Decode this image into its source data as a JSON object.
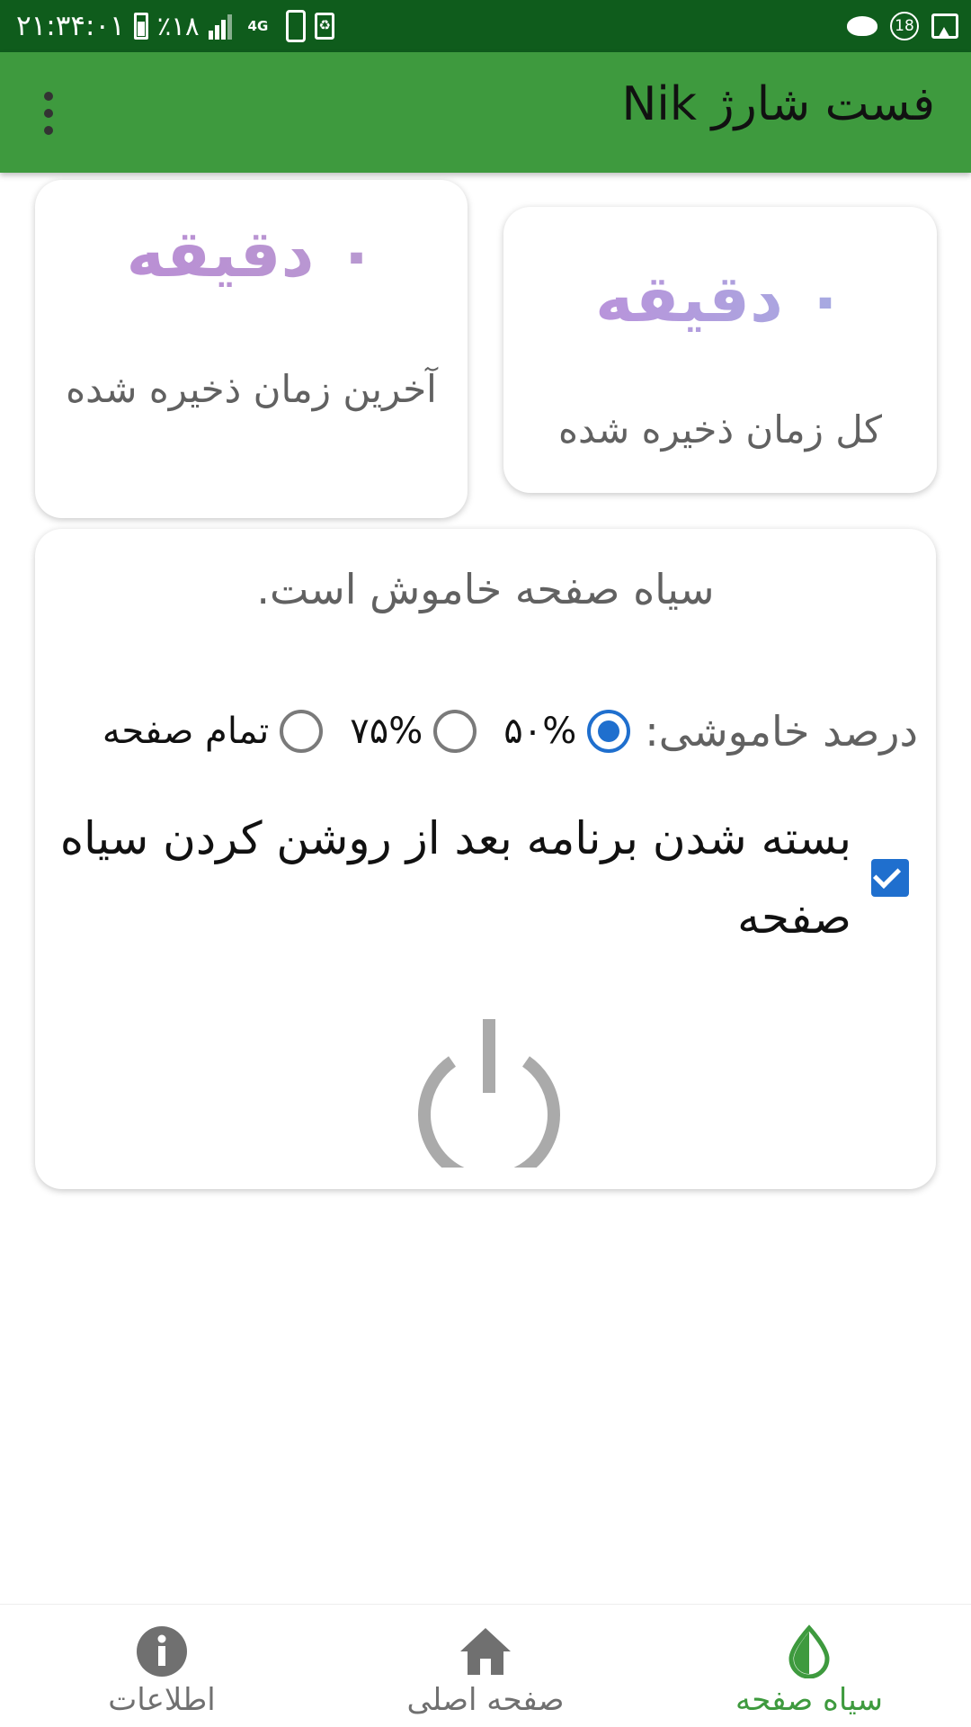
{
  "status_bar": {
    "time": "۲۱:۳۴:۰۱",
    "battery_percent": "٪۱۸",
    "network": "4G",
    "notification_badge": "18"
  },
  "app_bar": {
    "title": "فست شارژ Nik",
    "more_icon": "more-vert-icon"
  },
  "stats": {
    "last_saved": {
      "value": "۰ دقیقه",
      "label": "آخرین زمان ذخیره شده"
    },
    "total_saved": {
      "value": "۰ دقیقه",
      "label": "کل زمان ذخیره شده"
    }
  },
  "black_screen": {
    "status_text": "سیاه صفحه خاموش است.",
    "percent_label": "درصد خاموشی:",
    "options": [
      {
        "label": "۵۰%",
        "checked": true
      },
      {
        "label": "۷۵%",
        "checked": false
      },
      {
        "label": "تمام صفحه",
        "checked": false
      }
    ],
    "close_after_label": "بسته شدن برنامه بعد از روشن کردن سیاه صفحه",
    "close_after_checked": true,
    "power_icon": "power-icon"
  },
  "bottom_nav": {
    "items": [
      {
        "label": "سیاه صفحه",
        "icon": "drop-half-icon",
        "active": true
      },
      {
        "label": "صفحه اصلی",
        "icon": "home-icon",
        "active": false
      },
      {
        "label": "اطلاعات",
        "icon": "info-icon",
        "active": false
      }
    ]
  },
  "colors": {
    "status_bar": "#0f5c1c",
    "app_bar": "#3e9a3e",
    "accent_blue": "#1f6fce",
    "value_gradient_start": "#ba8bd6",
    "value_gradient_end": "#9fb3e4"
  }
}
